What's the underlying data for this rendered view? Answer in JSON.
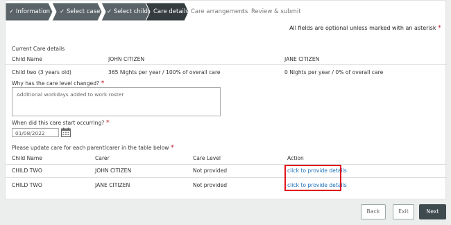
{
  "steps": [
    {
      "label": "Information",
      "state": "done"
    },
    {
      "label": "Select case",
      "state": "done"
    },
    {
      "label": "Select children",
      "state": "done"
    },
    {
      "label": "Care details",
      "state": "active"
    },
    {
      "label": "Care arrangements",
      "state": "todo"
    },
    {
      "label": "Review & submit",
      "state": "todo"
    }
  ],
  "notice": {
    "text": "All fields are optional unless marked with an asterisk",
    "asterisk": "*"
  },
  "current_care": {
    "heading": "Current Care details",
    "col_child": "Child Name",
    "col_parent1": "JOHN CITIZEN",
    "col_parent2": "JANE CITIZEN",
    "row": {
      "child": "Child two (3 years old)",
      "parent1": "365 Nights per year / 100% of overall care",
      "parent2": "0 Nights per year / 0% of overall care"
    }
  },
  "care_change": {
    "label": "Why has the care level changed?",
    "asterisk": "*",
    "value": "Additional workdays added to work roster"
  },
  "start_date": {
    "label": "When did this care start occurring?",
    "asterisk": "*",
    "value": "01/08/2022"
  },
  "update": {
    "label": "Please update care for each parent/carer in the table below",
    "asterisk": "*",
    "headers": {
      "child": "Child Name",
      "carer": "Carer",
      "level": "Care Level",
      "action": "Action"
    },
    "rows": [
      {
        "child": "CHILD TWO",
        "carer": "JOHN CITIZEN",
        "level": "Not provided",
        "action": "click to provide details"
      },
      {
        "child": "CHILD TWO",
        "carer": "JANE CITIZEN",
        "level": "Not provided",
        "action": "click to provide details"
      }
    ]
  },
  "buttons": {
    "back": "Back",
    "exit": "Exit",
    "next": "Next"
  },
  "colors": {
    "step_done": "#5a6367",
    "step_active": "#343c40",
    "required": "#c0272d",
    "link": "#1a6eb8",
    "highlight": "#e0141b"
  },
  "icons": {
    "done": "check-icon",
    "chevron": "chevron-right-icon",
    "calendar": "calendar-icon"
  }
}
